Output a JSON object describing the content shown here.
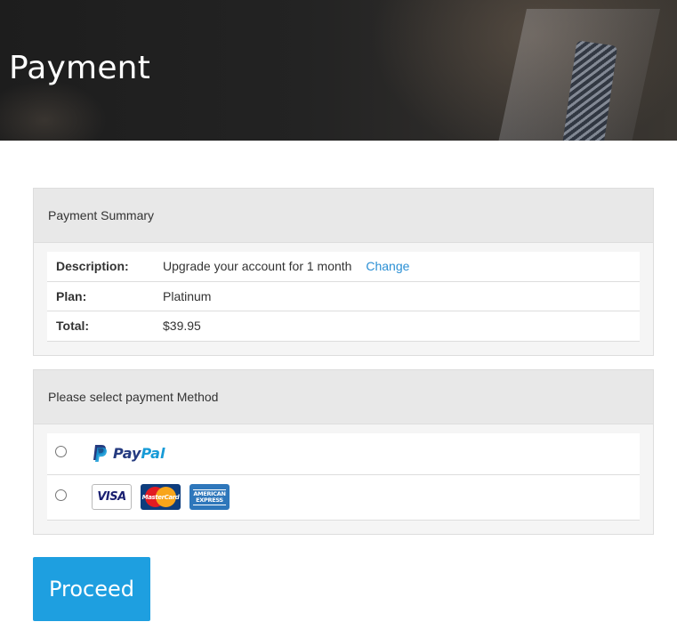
{
  "hero": {
    "title": "Payment"
  },
  "summary": {
    "header": "Payment Summary",
    "rows": [
      {
        "label": "Description:",
        "value": "Upgrade your account for 1 month",
        "link": "Change"
      },
      {
        "label": "Plan:",
        "value": "Platinum"
      },
      {
        "label": "Total:",
        "value": "$39.95"
      }
    ]
  },
  "methods": {
    "header": "Please select payment Method",
    "paypal": {
      "pay": "Pay",
      "pal": "Pal",
      "icon": "paypal-icon"
    },
    "cards": {
      "visa": "VISA",
      "mastercard": "MasterCard",
      "amex_line1": "AMERICAN",
      "amex_line2": "EXPRESS"
    }
  },
  "actions": {
    "proceed": "Proceed"
  },
  "colors": {
    "accent": "#1e9fe0",
    "link": "#2a8fd4",
    "paypal_dark": "#253b80",
    "paypal_light": "#179bd7"
  }
}
